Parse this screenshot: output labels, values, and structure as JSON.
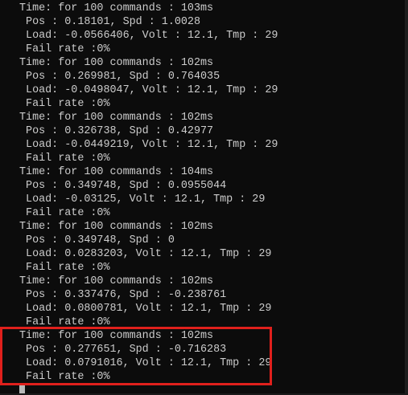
{
  "terminal": {
    "lines": [
      "Time: for 100 commands : 103ms",
      " Pos : 0.18101, Spd : 1.0028",
      " Load: -0.0566406, Volt : 12.1, Tmp : 29",
      " Fail rate :0%",
      "Time: for 100 commands : 102ms",
      " Pos : 0.269981, Spd : 0.764035",
      " Load: -0.0498047, Volt : 12.1, Tmp : 29",
      " Fail rate :0%",
      "Time: for 100 commands : 102ms",
      " Pos : 0.326738, Spd : 0.42977",
      " Load: -0.0449219, Volt : 12.1, Tmp : 29",
      " Fail rate :0%",
      "Time: for 100 commands : 104ms",
      " Pos : 0.349748, Spd : 0.0955044",
      " Load: -0.03125, Volt : 12.1, Tmp : 29",
      " Fail rate :0%",
      "Time: for 100 commands : 102ms",
      " Pos : 0.349748, Spd : 0",
      " Load: 0.0283203, Volt : 12.1, Tmp : 29",
      " Fail rate :0%",
      "Time: for 100 commands : 102ms",
      " Pos : 0.337476, Spd : -0.238761",
      " Load: 0.0800781, Volt : 12.1, Tmp : 29",
      " Fail rate :0%",
      "Time: for 100 commands : 102ms",
      " Pos : 0.277651, Spd : -0.716283",
      " Load: 0.0791016, Volt : 12.1, Tmp : 29",
      " Fail rate :0%"
    ]
  },
  "colors": {
    "background": "#0c0c0c",
    "text": "#cccccc",
    "highlight_border": "#e0201c"
  }
}
